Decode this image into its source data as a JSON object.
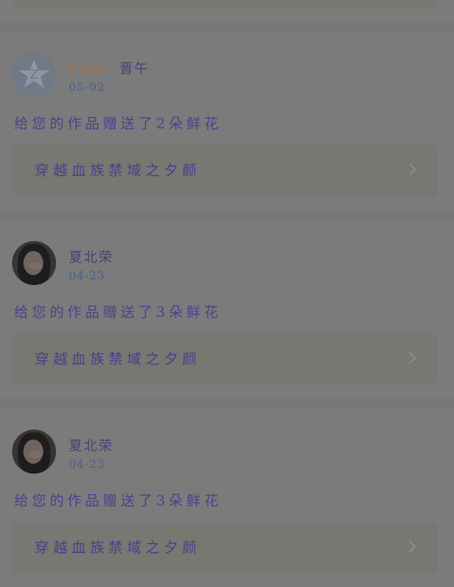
{
  "feed": {
    "items": [
      {
        "avatar": "default-avatar-icon",
        "name_decor": "Cane",
        "name": "晋午",
        "date": "05-02",
        "message": "给您的作品赠送了2朵鲜花",
        "link_title": "穿越血族禁域之夕颜"
      },
      {
        "avatar": "photo-avatar",
        "name_decor": "",
        "name": "夏北荣",
        "date": "04-23",
        "message": "给您的作品赠送了3朵鲜花",
        "link_title": "穿越血族禁域之夕颜"
      },
      {
        "avatar": "photo-avatar",
        "name_decor": "",
        "name": "夏北荣",
        "date": "04-23",
        "message": "给您的作品赠送了3朵鲜花",
        "link_title": "穿越血族禁域之夕颜"
      }
    ]
  },
  "colors": {
    "background": "#7c7c7c",
    "link_box": "#767872",
    "message_text": "#4f3f8d",
    "date_text": "#4a5f88",
    "decor_name": "#a26d43"
  }
}
